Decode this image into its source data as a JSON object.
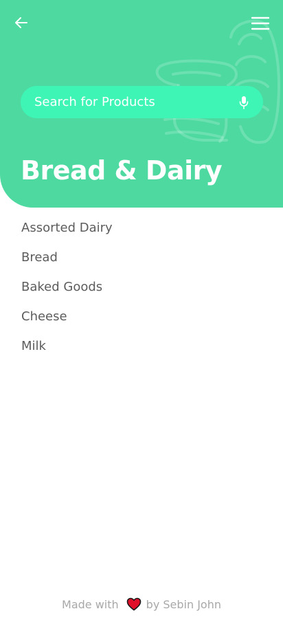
{
  "header": {
    "title": "Bread & Dairy",
    "background_color": "#4dd9a0",
    "illustration_icon": "bread-loaf-icon",
    "back_icon": "arrow-left-icon",
    "menu_icon": "hamburger-menu-icon"
  },
  "search": {
    "placeholder": "Search for Products",
    "value": "",
    "background_color": "#3ef5b6",
    "mic_icon": "microphone-icon"
  },
  "categories": [
    "Assorted Dairy",
    "Bread",
    "Baked Goods",
    "Cheese",
    "Milk"
  ],
  "footer": {
    "prefix": "Made with",
    "suffix": "by Sebin John",
    "heart_icon": "heart-icon",
    "heart_color": "#e0102a"
  }
}
